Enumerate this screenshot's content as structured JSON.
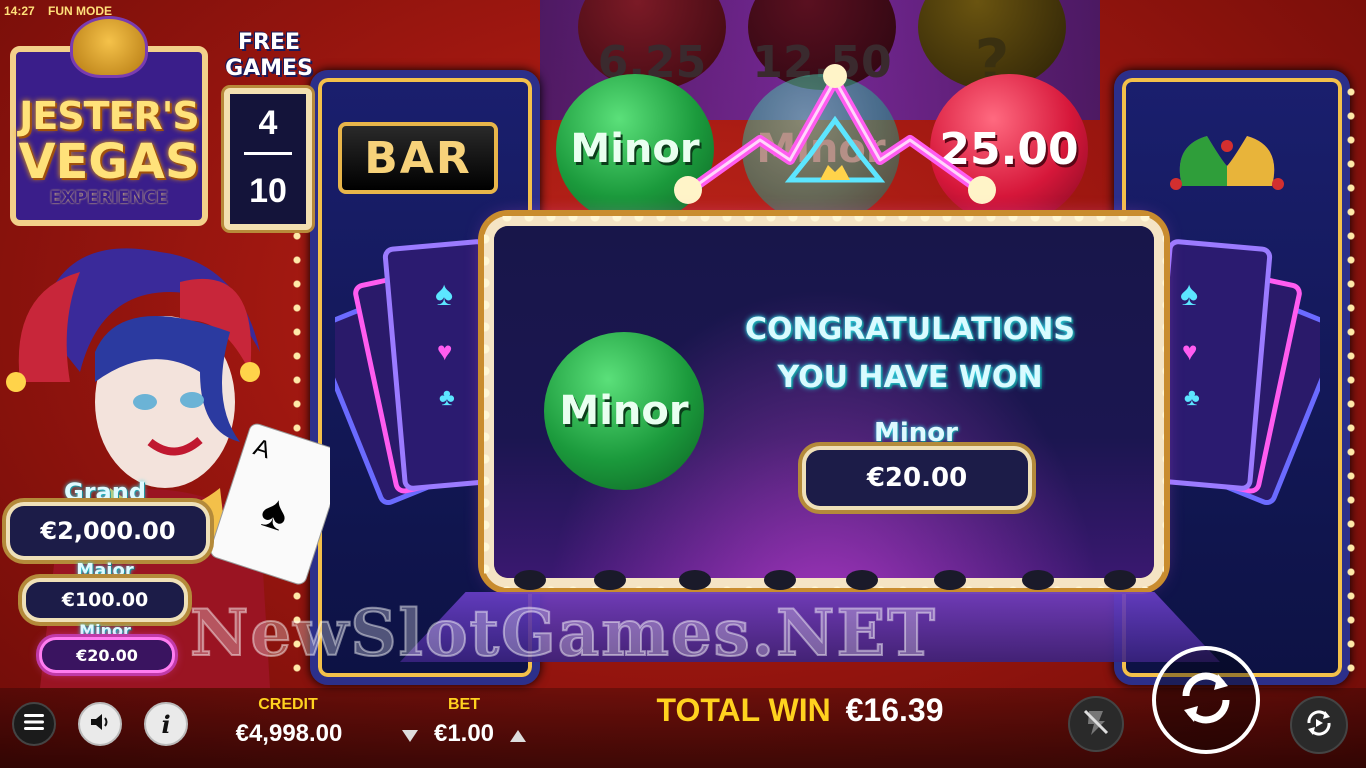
{
  "status_bar": {
    "time": "14:27",
    "mode": "FUN MODE"
  },
  "logo": {
    "line1": "JESTER'S",
    "line2": "VEGAS",
    "line3": "EXPERIENCE"
  },
  "free_games": {
    "label_line1": "FREE",
    "label_line2": "GAMES",
    "current": "4",
    "total": "10"
  },
  "top_orbs": [
    {
      "label": "6.25",
      "color": "#5a0e16"
    },
    {
      "label": "12.50",
      "color": "#3a0a14"
    },
    {
      "label": "?",
      "color": "#4a3a10"
    }
  ],
  "reel_orbs": [
    {
      "label": "Minor",
      "color": "#1b9a3c"
    },
    {
      "label": "Minor",
      "color": "#2aa58c"
    },
    {
      "label": "25.00",
      "color": "#d6173a"
    }
  ],
  "reel_symbol": {
    "label": "BAR"
  },
  "jackpots": {
    "grand": {
      "label": "Grand",
      "value": "€2,000.00"
    },
    "major": {
      "label": "Major",
      "value": "€100.00"
    },
    "minor": {
      "label": "Minor",
      "value": "€20.00"
    }
  },
  "popup": {
    "orb_label": "Minor",
    "title_line1": "CONGRATULATIONS",
    "title_line2": "YOU HAVE WON",
    "prize_label": "Minor",
    "prize_value": "€20.00"
  },
  "watermark": "NewSlotGames.NET",
  "bottom": {
    "credit_label": "CREDIT",
    "credit_value": "€4,998.00",
    "bet_label": "BET",
    "bet_value": "€1.00",
    "total_win_label": "TOTAL WIN",
    "total_win_value": "€16.39"
  },
  "icons": {
    "menu": "menu-icon",
    "sound": "sound-icon",
    "info": "info-icon",
    "turbo": "turbo-off-icon",
    "spin": "spin-icon",
    "autoplay": "autoplay-icon"
  },
  "colors": {
    "accent_gold": "#ffd21f",
    "neon_cyan": "#3be0f0",
    "neon_pink": "#ff66ff",
    "background_red": "#9e1710"
  }
}
